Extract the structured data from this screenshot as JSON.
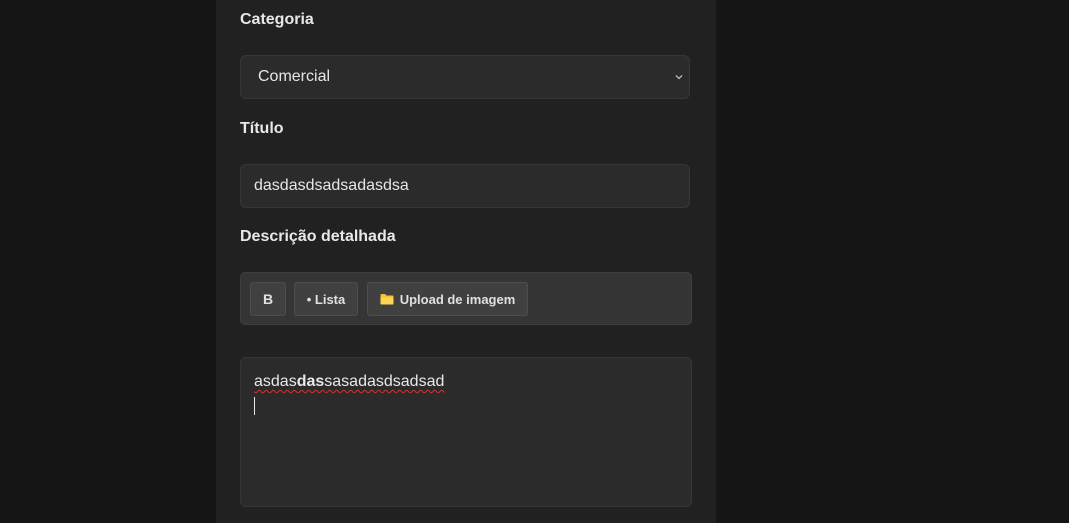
{
  "form": {
    "category": {
      "label": "Categoria",
      "selected": "Comercial"
    },
    "title": {
      "label": "Título",
      "value": "dasdasdsadsadasdsa"
    },
    "description": {
      "label": "Descrição detalhada",
      "toolbar": {
        "bold_label": "B",
        "list_label": "• Lista",
        "upload_label": "Upload de imagem",
        "upload_icon": "folder-icon"
      },
      "editor": {
        "text_before": "asdas",
        "text_bold": "das",
        "text_after": "sasadasdsadsad"
      }
    }
  },
  "colors": {
    "page_background": "#151515",
    "panel_background": "#212121",
    "field_background": "#2b2b2b",
    "toolbar_background": "#353535",
    "folder_yellow": "#f2c230",
    "spellcheck_red": "#d93030"
  }
}
